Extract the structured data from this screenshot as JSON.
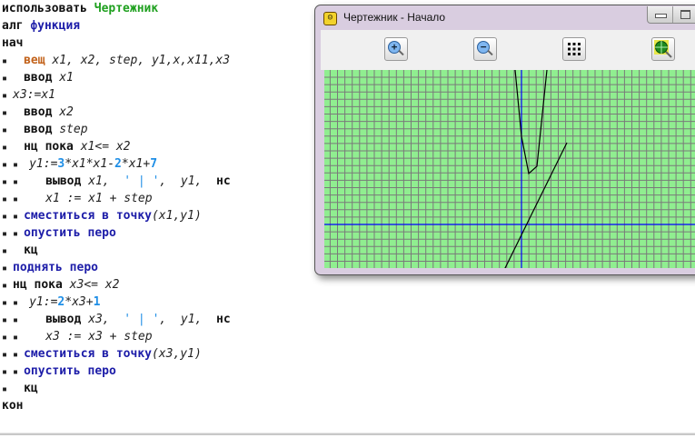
{
  "editor": {
    "lines": [
      {
        "marks": "",
        "segs": [
          [
            "kw",
            "использовать "
          ],
          [
            "grn",
            "Чертежник"
          ]
        ]
      },
      {
        "marks": "",
        "segs": [
          [
            "kw",
            "алг "
          ],
          [
            "kwb",
            "функция"
          ]
        ]
      },
      {
        "marks": "",
        "segs": [
          [
            "kw",
            "нач"
          ]
        ]
      },
      {
        "marks": "▪   ",
        "segs": [
          [
            "kwo",
            "вещ "
          ],
          [
            "var",
            "x1, x2, step, y1,x,x11,x3"
          ]
        ]
      },
      {
        "marks": "▪   ",
        "segs": [
          [
            "kw",
            "ввод "
          ],
          [
            "var",
            "x1"
          ]
        ]
      },
      {
        "marks": "▪ ",
        "segs": [
          [
            "var",
            "x3:=x1"
          ]
        ]
      },
      {
        "marks": "▪   ",
        "segs": [
          [
            "kw",
            "ввод "
          ],
          [
            "var",
            "x2"
          ]
        ]
      },
      {
        "marks": "▪   ",
        "segs": [
          [
            "kw",
            "ввод "
          ],
          [
            "var",
            "step"
          ]
        ]
      },
      {
        "marks": "▪   ",
        "segs": [
          [
            "kw",
            "нц пока "
          ],
          [
            "var",
            "x1<= x2"
          ]
        ]
      },
      {
        "marks": "▪ ▪  ",
        "segs": [
          [
            "var",
            "y1:="
          ],
          [
            "num",
            "3"
          ],
          [
            "var",
            "*x1*x1-"
          ],
          [
            "num",
            "2"
          ],
          [
            "var",
            "*x1+"
          ],
          [
            "num",
            "7"
          ]
        ]
      },
      {
        "marks": "▪ ▪     ",
        "segs": [
          [
            "kw",
            "вывод "
          ],
          [
            "var",
            "x1,  "
          ],
          [
            "str",
            "' | '"
          ],
          [
            "var",
            ",  y1,  "
          ],
          [
            "kw",
            "нс"
          ]
        ]
      },
      {
        "marks": "▪ ▪     ",
        "segs": [
          [
            "var",
            "x1 := x1 + step"
          ]
        ]
      },
      {
        "marks": "▪ ▪ ",
        "segs": [
          [
            "kwb",
            "сместиться в точку"
          ],
          [
            "var",
            "(x1,y1)"
          ]
        ]
      },
      {
        "marks": "▪ ▪ ",
        "segs": [
          [
            "kwb",
            "опустить перо"
          ]
        ]
      },
      {
        "marks": "▪   ",
        "segs": [
          [
            "kw",
            "кц"
          ]
        ]
      },
      {
        "marks": "▪ ",
        "segs": [
          [
            "kwb",
            "поднять перо"
          ]
        ]
      },
      {
        "marks": "▪ ",
        "segs": [
          [
            "kw",
            "нц пока "
          ],
          [
            "var",
            "x3<= x2"
          ]
        ]
      },
      {
        "marks": "▪ ▪  ",
        "segs": [
          [
            "var",
            "y1:="
          ],
          [
            "num",
            "2"
          ],
          [
            "var",
            "*x3+"
          ],
          [
            "num",
            "1"
          ]
        ]
      },
      {
        "marks": "▪ ▪     ",
        "segs": [
          [
            "kw",
            "вывод "
          ],
          [
            "var",
            "x3,  "
          ],
          [
            "str",
            "' | '"
          ],
          [
            "var",
            ",  y1,  "
          ],
          [
            "kw",
            "нс"
          ]
        ]
      },
      {
        "marks": "▪ ▪     ",
        "segs": [
          [
            "var",
            "x3 := x3 + step"
          ]
        ]
      },
      {
        "marks": "▪ ▪ ",
        "segs": [
          [
            "kwb",
            "сместиться в точку"
          ],
          [
            "var",
            "(x3,y1)"
          ]
        ]
      },
      {
        "marks": "▪ ▪ ",
        "segs": [
          [
            "kwb",
            "опустить перо"
          ]
        ]
      },
      {
        "marks": "▪   ",
        "segs": [
          [
            "kw",
            "кц"
          ]
        ]
      },
      {
        "marks": "",
        "segs": [
          [
            "kw",
            "кон"
          ]
        ]
      }
    ]
  },
  "window": {
    "title": "Чертежник - Начало",
    "app_icon": "smiley-icon",
    "toolbar": [
      "zoom-in-icon",
      "zoom-out-icon",
      "grid-icon",
      "zoom-fit-icon"
    ],
    "colors": {
      "canvas": "#90ee90",
      "grid": "#7a7a7a",
      "axes": "#0000ff",
      "pen": "#000000"
    }
  }
}
